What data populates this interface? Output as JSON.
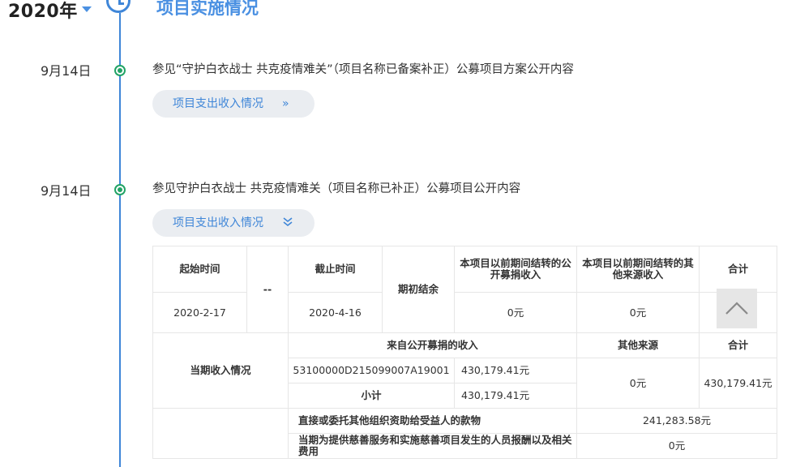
{
  "header": {
    "year": "2020年",
    "section_title": "项目实施情况"
  },
  "items": [
    {
      "date": "9月14日",
      "title": "参见“守护白衣战士 共克疫情难关”（项目名称已备案补正）公募项目方案公开内容",
      "toggle_label": "项目支出收入情况",
      "toggle_icon": "»"
    },
    {
      "date": "9月14日",
      "title": "参见守护白衣战士 共克疫情难关（项目名称已补正）公募项目公开内容",
      "toggle_label": "项目支出收入情况",
      "toggle_icon": "double-chevron-down"
    }
  ],
  "table": {
    "h_start": "起始时间",
    "h_dash": "--",
    "h_end": "截止时间",
    "h_opening": "期初结余",
    "h_prev_public": "本项目以前期间结转的公开募捐收入",
    "h_prev_other": "本项目以前期间结转的其他来源收入",
    "h_total": "合计",
    "start_date": "2020-2-17",
    "end_date": "2020-4-16",
    "prev_public_val": "0元",
    "prev_other_val": "0元",
    "income_label": "当期收入情况",
    "h_public_income": "来自公开募捐的收入",
    "h_other_source": "其他来源",
    "h_total2": "合计",
    "record_no": "53100000D215099007A19001",
    "record_amount": "430,179.41元",
    "subtotal_label": "小计",
    "subtotal_amount": "430,179.41元",
    "other_source_val": "0元",
    "income_total": "430,179.41元",
    "expense_row1_label": "直接或委托其他组织资助给受益人的款物",
    "expense_row1_val": "241,283.58元",
    "expense_row2_label": "当期为提供慈善服务和实施慈善项目发生的人员报酬以及相关费用",
    "expense_row2_val": "0元"
  }
}
